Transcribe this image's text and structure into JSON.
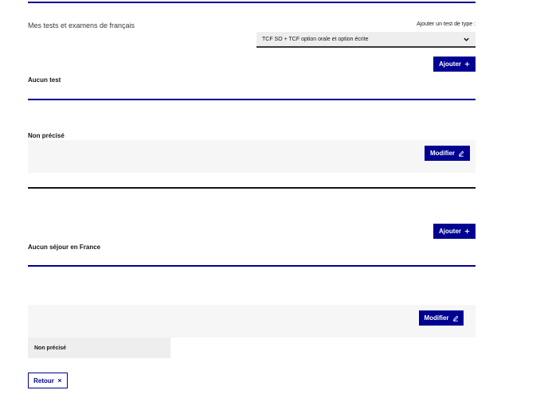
{
  "french_tests": {
    "title": "Mes tests et examens de français",
    "add_type_label": "Ajouter un test de type :",
    "selected_type": "TCF SO + TCF option orale et option écrite",
    "add_button_label": "Ajouter",
    "empty_label": "Aucun test"
  },
  "unspecified_block": {
    "label": "Non précisé",
    "modify_button_label": "Modifier"
  },
  "stays_in_france": {
    "add_button_label": "Ajouter",
    "empty_label": "Aucun séjour en France"
  },
  "second_block": {
    "modify_button_label": "Modifier",
    "cell_label": "Non précisé"
  },
  "footer": {
    "back_button_label": "Retour"
  },
  "colors": {
    "primary": "#000091",
    "panel_grey": "#f6f6f6",
    "text": "#161616"
  },
  "icons": {
    "chevron": "chevron-down-icon",
    "plus": "plus-icon",
    "edit": "pencil-icon",
    "close": "close-icon"
  }
}
